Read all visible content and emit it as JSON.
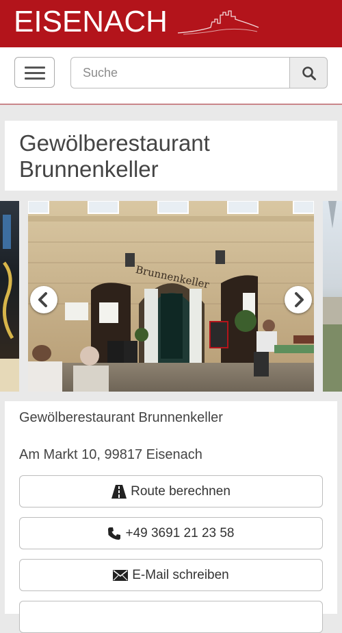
{
  "header": {
    "brand": "EISENACH",
    "brand_color": "#b3141b"
  },
  "toolbar": {
    "search_placeholder": "Suche"
  },
  "title_card": {
    "title": "Gewölberestaurant Brunnenkeller"
  },
  "gallery": {
    "sign_text": "Brunnenkeller"
  },
  "info": {
    "name": "Gewölberestaurant Brunnenkeller",
    "address": "Am Markt 10, 99817 Eisenach",
    "actions": [
      {
        "label": "Route berechnen",
        "icon": "road-icon"
      },
      {
        "label": "+49 3691 21 23 58",
        "icon": "phone-icon"
      },
      {
        "label": "E-Mail schreiben",
        "icon": "envelope-icon"
      }
    ]
  }
}
